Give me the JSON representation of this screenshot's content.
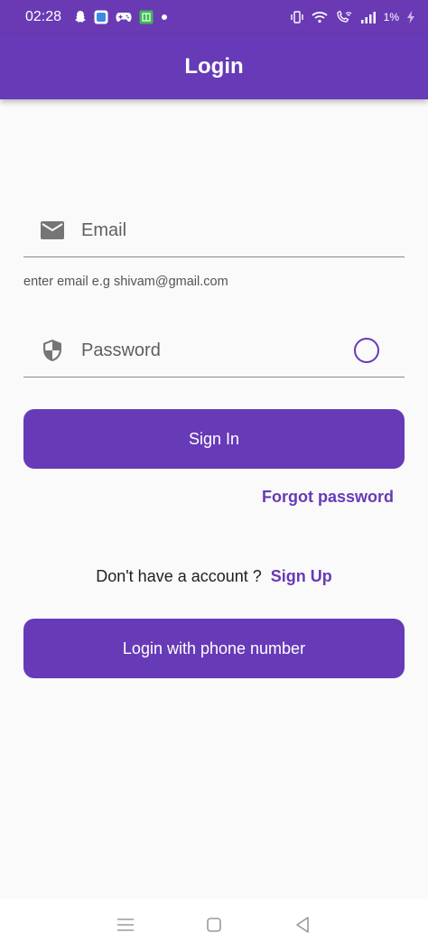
{
  "status_bar": {
    "time": "02:28",
    "battery": "1%",
    "left_icons": [
      "snapchat-icon",
      "app-icon",
      "gamepad-icon",
      "store-icon",
      "dot-icon"
    ],
    "right_icons": [
      "vibrate-icon",
      "wifi-icon",
      "wifi-calling-icon",
      "signal-icon",
      "charging-icon"
    ]
  },
  "app_bar": {
    "title": "Login"
  },
  "email_field": {
    "placeholder": "Email",
    "value": "",
    "helper": "enter email e.g shivam@gmail.com",
    "icon": "mail-icon"
  },
  "password_field": {
    "placeholder": "Password",
    "value": "",
    "icon": "shield-icon",
    "toggle_icon": "circle-icon"
  },
  "signin_button": {
    "label": "Sign In"
  },
  "forgot_link": {
    "label": "Forgot password"
  },
  "signup": {
    "prompt": "Don't have a account ?",
    "link": "Sign Up"
  },
  "phone_button": {
    "label": "Login with phone number"
  },
  "nav_bar": {
    "icons": [
      "menu-icon",
      "home-square-icon",
      "back-triangle-icon"
    ]
  },
  "colors": {
    "primary": "#673ab7",
    "status_bar": "#6a3ab4",
    "background": "#fafafa",
    "text": "#1f1f1f",
    "hint": "#5f5f5f"
  }
}
